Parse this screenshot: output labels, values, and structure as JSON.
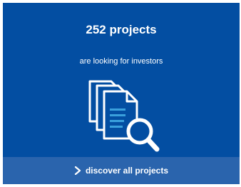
{
  "card": {
    "headline": "252 projects",
    "subline": "are looking for investors",
    "illustration_icon": "documents-search-icon",
    "cta": {
      "label": "discover all projects",
      "icon": "chevron-right-icon"
    }
  },
  "colors": {
    "card_background": "#034ea2",
    "cta_background": "#2a64ad",
    "text": "#ffffff",
    "accent": "#3aa0dc"
  }
}
